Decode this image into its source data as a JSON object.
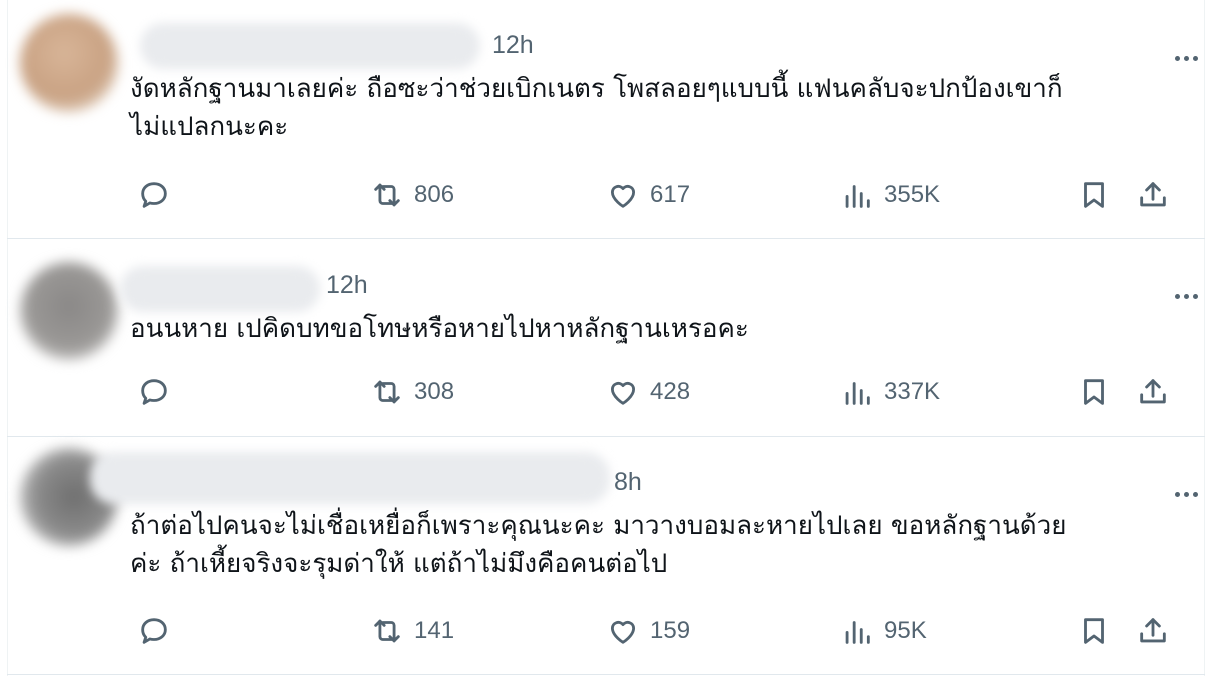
{
  "posts": [
    {
      "time": "12h",
      "text_line1": "งัดหลักฐานมาเลยค่ะ ถือซะว่าช่วยเบิกเนตร โพสลอยๆแบบนี้ แฟนคลับจะปกป้องเขาก็",
      "text_line2": "ไม่แปลกนะคะ",
      "replies": "",
      "reposts": "806",
      "likes": "617",
      "views": "355K",
      "avatar_color": "#cfa98a"
    },
    {
      "time": "12h",
      "text_line1": "อนนหาย เปคิดบทขอโทษหรือหายไปหาหลักฐานเหรอคะ",
      "text_line2": "",
      "replies": "",
      "reposts": "308",
      "likes": "428",
      "views": "337K",
      "avatar_color": "#8f8d8c"
    },
    {
      "time": "8h",
      "text_line1": "ถ้าต่อไปคนจะไม่เชื่อเหยื่อก็เพราะคุณนะคะ มาวางบอมละหายไปเลย ขอหลักฐานด้วย",
      "text_line2": "ค่ะ ถ้าเหี้ยจริงจะรุมด่าให้ แต่ถ้าไม่มึงคือคนต่อไป",
      "replies": "",
      "reposts": "141",
      "likes": "159",
      "views": "95K",
      "avatar_color": "#7e7e7e"
    }
  ],
  "colors": {
    "text": "#0f1419",
    "secondary": "#536471",
    "divider": "#e1e8ed"
  },
  "icons": {
    "reply": "reply-icon",
    "repost": "repost-icon",
    "like": "heart-icon",
    "views": "views-icon",
    "bookmark": "bookmark-icon",
    "share": "share-icon",
    "more": "more-icon"
  }
}
